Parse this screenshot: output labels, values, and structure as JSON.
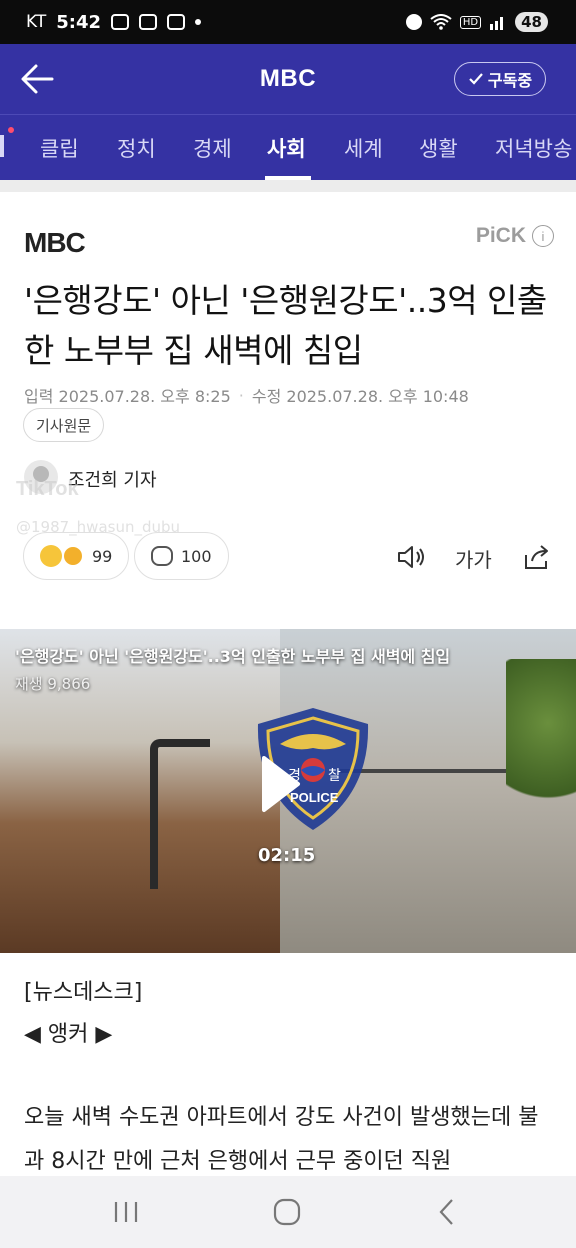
{
  "status_bar": {
    "carrier": "KT",
    "time": "5:42",
    "battery": "48",
    "hd_label": "HD"
  },
  "header": {
    "title": "MBC",
    "subscribe_label": "구독중"
  },
  "tabs": [
    {
      "label": "클립"
    },
    {
      "label": "정치"
    },
    {
      "label": "경제"
    },
    {
      "label": "사회",
      "active": true
    },
    {
      "label": "세계"
    },
    {
      "label": "생활"
    },
    {
      "label": "저녁방송"
    }
  ],
  "article": {
    "press_logo": "MBC",
    "pick_label": "PiCK",
    "headline": "'은행강도' 아닌 '은행원강도'..3억 인출한 노부부 집 새벽에 침입",
    "published": "입력 2025.07.28. 오후 8:25",
    "modified": "수정 2025.07.28. 오후 10:48",
    "source_button": "기사원문",
    "reporter": "조건희 기자",
    "reaction_count": "99",
    "comment_count": "100",
    "font_size_label": "가가"
  },
  "watermark": {
    "brand": "TikTok",
    "handle": "@1987_hwasun_dubu"
  },
  "video": {
    "title": "'은행강도' 아닌 '은행원강도'..3억 인출한 노부부 집 새벽에 침입",
    "views": "재생 9,866",
    "duration": "02:15",
    "emblem_text_left": "경",
    "emblem_text_right": "찰",
    "emblem_text_bottom": "POLICE"
  },
  "body": {
    "section_tag": "[뉴스데스크]",
    "anchor": "◀ 앵커 ▶",
    "paragraph": "오늘 새벽 수도권 아파트에서 강도 사건이 발생했는데 불과 8시간 만에 근처 은행에서 근무 중이던 직원"
  },
  "colors": {
    "brand": "#3532a3",
    "background": "#ffffff"
  },
  "icons": [
    "back-arrow-icon",
    "check-icon",
    "info-icon",
    "speaker-icon",
    "share-icon",
    "play-icon",
    "recent-apps-icon",
    "home-icon",
    "nav-back-icon"
  ]
}
